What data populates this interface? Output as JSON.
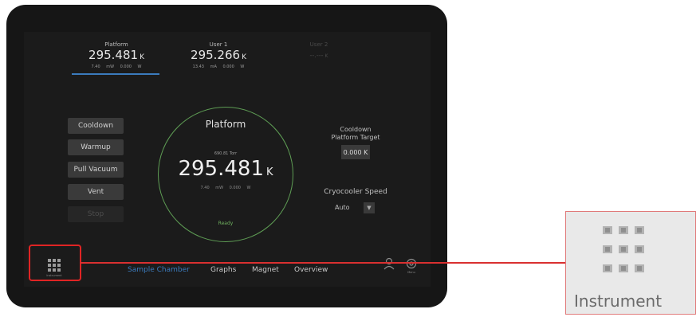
{
  "readouts": [
    {
      "label": "Platform",
      "value": "295.481",
      "unit": "K",
      "sub": "7.40 mW  0.000 W"
    },
    {
      "label": "User 1",
      "value": "295.266",
      "unit": "K",
      "sub": "13.43 mA  0.000 W"
    },
    {
      "label": "User 2",
      "value": "--.---",
      "unit": "K",
      "sub": ""
    }
  ],
  "commands": [
    "Cooldown",
    "Warmup",
    "Pull Vacuum",
    "Vent",
    "Stop"
  ],
  "ring": {
    "title": "Platform",
    "pressure": "690.81 Torr",
    "temperature": "295.481",
    "unit": "K",
    "power": "7.40 mW  0.000 W",
    "status": "Ready"
  },
  "target": {
    "label_line1": "Cooldown",
    "label_line2": "Platform Target",
    "value": "0.000 K"
  },
  "speed": {
    "label": "Cryocooler Speed",
    "value": "Auto"
  },
  "nav": {
    "instrument_caption": "Instrument",
    "tabs": [
      "Sample Chamber",
      "Graphs",
      "Magnet",
      "Overview"
    ],
    "menu_caption": "Menu"
  },
  "zoom": {
    "caption": "Instrument"
  },
  "colors": {
    "accent": "#3b7bbd",
    "ring": "#5e9c54",
    "highlight": "#e02424"
  }
}
